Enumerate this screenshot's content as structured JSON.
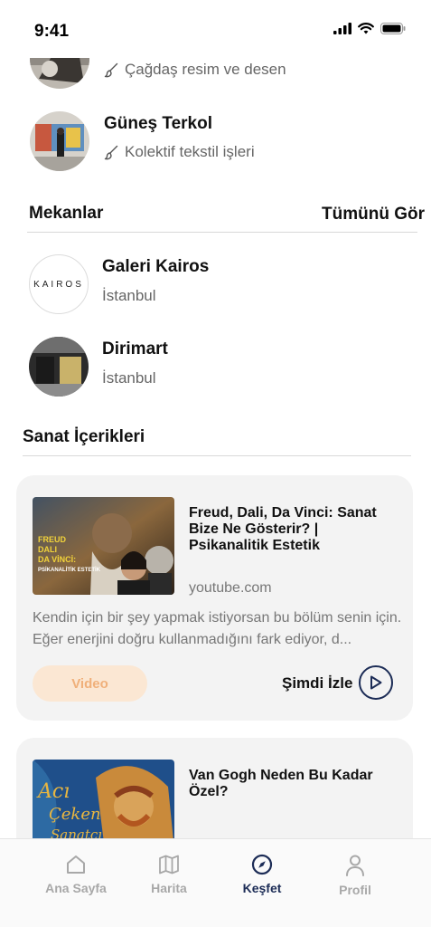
{
  "status_bar": {
    "time": "9:41"
  },
  "artists": [
    {
      "category": "Çağdaş resim ve desen"
    },
    {
      "name": "Güneş Terkol",
      "category": "Kolektif tekstil işleri"
    }
  ],
  "venues_section": {
    "title": "Mekanlar",
    "see_all": "Tümünü Gör",
    "items": [
      {
        "name": "Galeri Kairos",
        "city": "İstanbul",
        "logo_text": "KAIROS"
      },
      {
        "name": "Dirimart",
        "city": "İstanbul"
      }
    ]
  },
  "content_section": {
    "title": "Sanat İçerikleri",
    "cards": [
      {
        "title": "Freud, Dali, Da Vinci: Sanat Bize Ne Gösterir? | Psikanalitik Estetik",
        "source": "youtube.com",
        "description": "Kendin için bir şey yapmak istiyorsan bu bölüm senin için. Eğer enerjini doğru kullanmadığını fark ediyor, d...",
        "badge": "Video",
        "action": "Şimdi İzle",
        "thumb_text": [
          "FREUD",
          "DALI",
          "DA VİNCİ:",
          "PSİKANALİTİK ESTETİK"
        ]
      },
      {
        "title": "Van Gogh Neden Bu Kadar Özel?",
        "thumb_text": [
          "Acı",
          "Çeken",
          "Sanatçı"
        ]
      }
    ]
  },
  "bottom_nav": {
    "items": [
      {
        "label": "Ana Sayfa",
        "icon": "home-icon",
        "active": false
      },
      {
        "label": "Harita",
        "icon": "map-icon",
        "active": false
      },
      {
        "label": "Keşfet",
        "icon": "compass-icon",
        "active": true
      },
      {
        "label": "Profil",
        "icon": "user-icon",
        "active": false
      }
    ]
  },
  "colors": {
    "accent": "#1c2c56",
    "badge_bg": "#fbe7d3",
    "badge_text": "#f0b07a",
    "card_bg": "#f3f3f3",
    "secondary_text": "#777777"
  }
}
